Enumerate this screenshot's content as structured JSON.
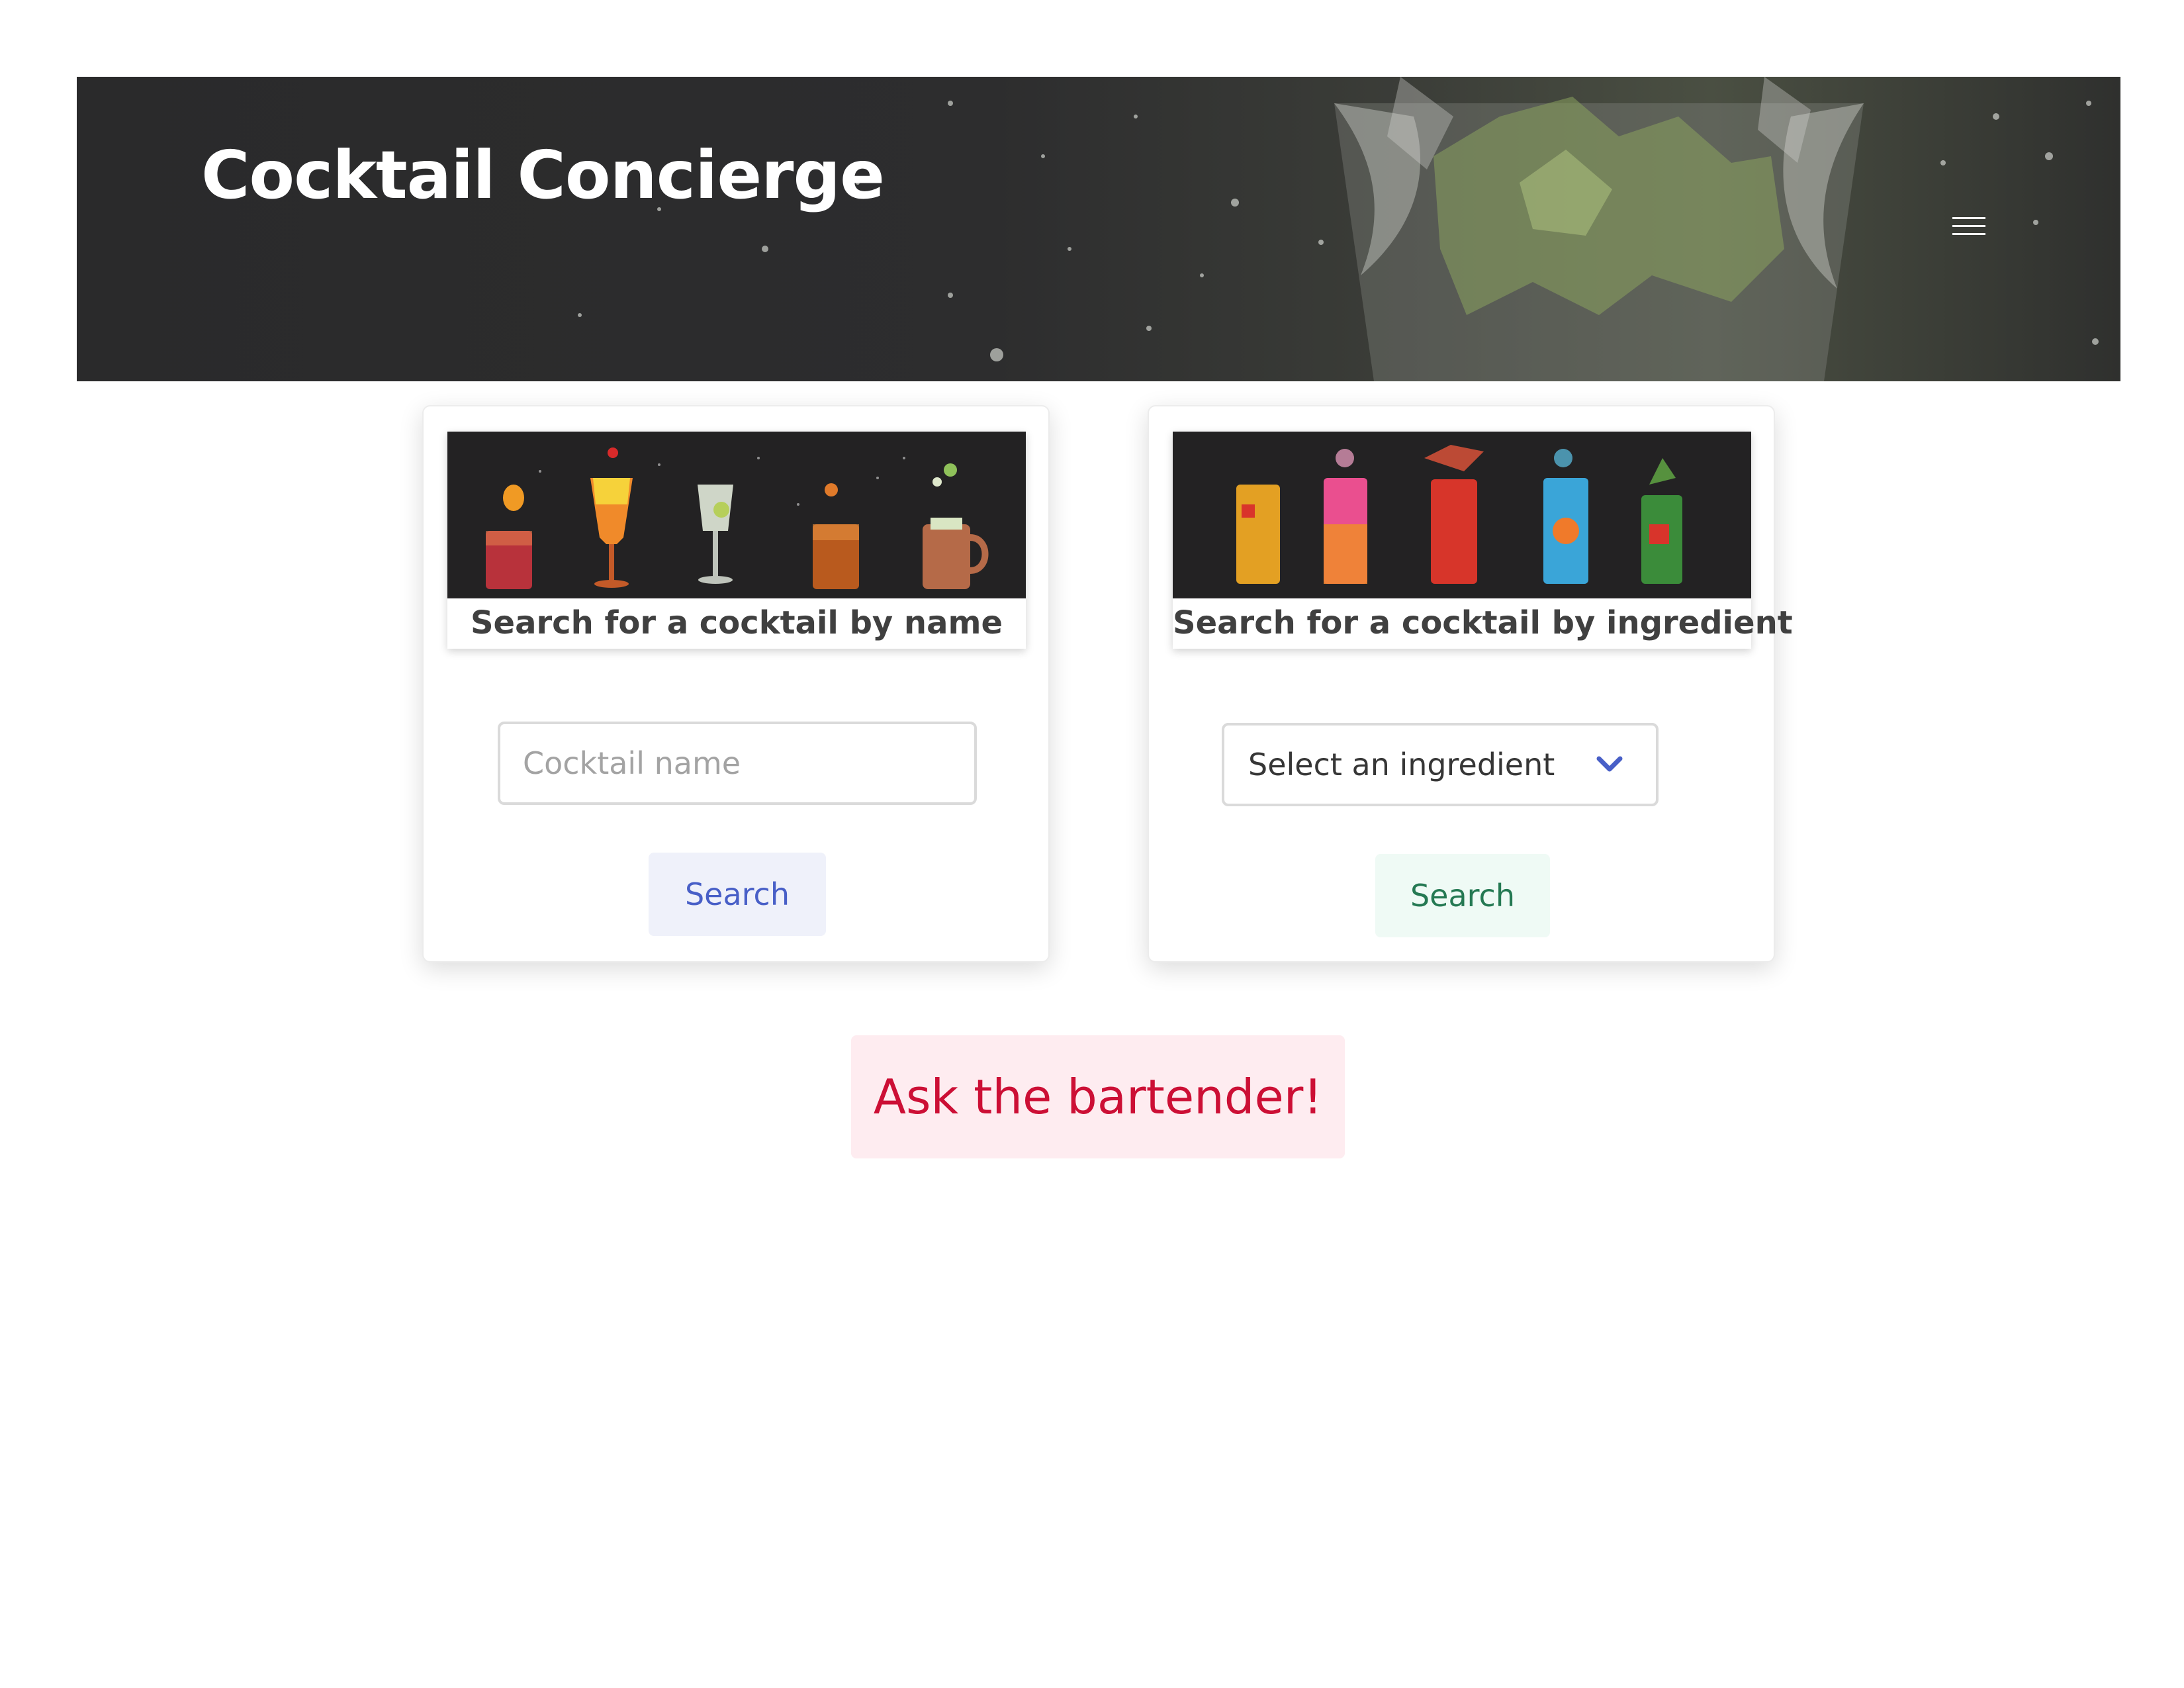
{
  "header": {
    "title": "Cocktail Concierge",
    "menu_icon": "hamburger-menu-icon"
  },
  "name_search": {
    "caption": "Search for a cocktail by name",
    "input_placeholder": "Cocktail name",
    "input_value": "",
    "button_label": "Search",
    "button_color": "#485fc7"
  },
  "ingredient_search": {
    "caption": "Search for a cocktail by ingredient",
    "select_value": "Select an ingredient",
    "select_icon": "chevron-down-icon",
    "button_label": "Search",
    "button_color": "#257953"
  },
  "bartender": {
    "button_label": "Ask the bartender!",
    "button_color": "#cc0f35"
  }
}
